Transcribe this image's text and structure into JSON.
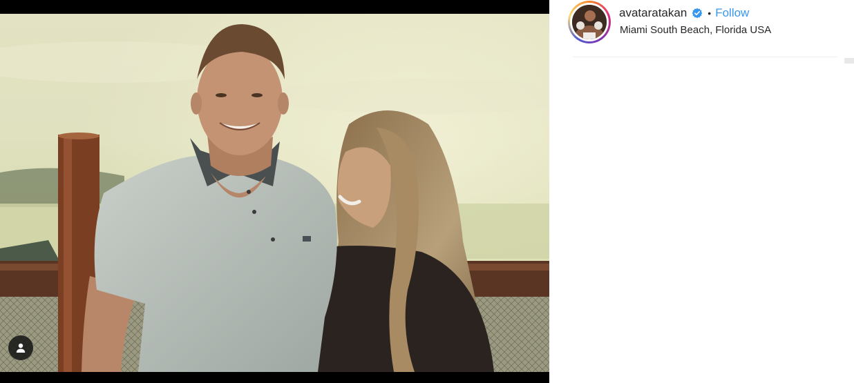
{
  "post": {
    "image_alt": "",
    "tag_icon": "user-tag-icon"
  },
  "header": {
    "avatar_icon": "profile-avatar",
    "username": "avataratakan",
    "verified_icon": "verified-badge-icon",
    "separator": "•",
    "follow_label": "Follow",
    "location": "Miami South Beach, Florida USA"
  },
  "colors": {
    "link_blue": "#3897f0",
    "text": "#262626",
    "divider": "#efefef"
  }
}
